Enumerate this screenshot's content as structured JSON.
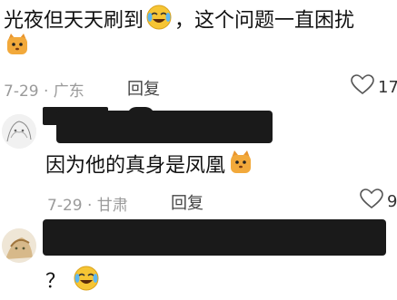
{
  "comment1": {
    "text": "光夜但天天刷到",
    "text_after": "，这个问题一直困扰",
    "meta": "7-29 · 广东",
    "reply_label": "回复",
    "likes": "17"
  },
  "reply1": {
    "text": "因为他的真身是凤凰",
    "meta": "7-29 · 甘肃",
    "reply_label": "回复",
    "likes": "9"
  },
  "reply2": {
    "text": "？"
  },
  "icons": {
    "emoji_cry_laugh": "crying-laughing-emoji",
    "emoji_cat": "cat-face-emoji",
    "heart": "heart-outline-icon"
  },
  "colors": {
    "meta": "#9a9a9a",
    "redaction": "#1a1a1a",
    "emoji_yellow": "#f6c534",
    "cat_orange": "#e9962e"
  }
}
